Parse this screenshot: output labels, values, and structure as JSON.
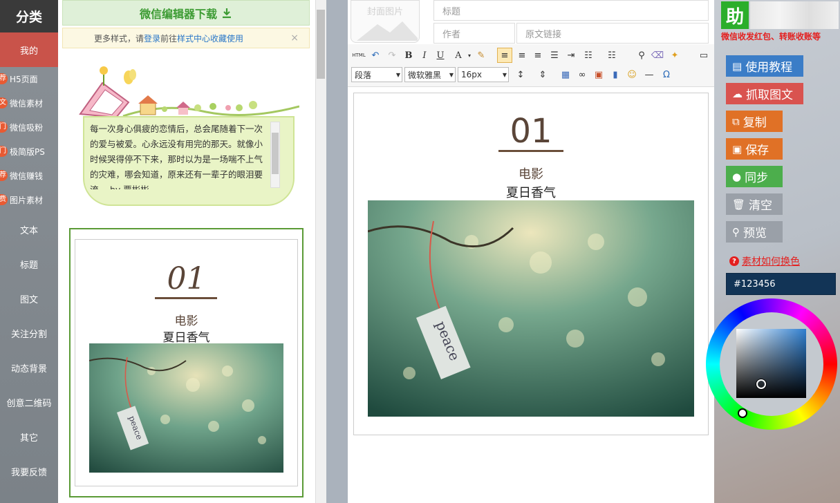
{
  "sidebar": {
    "header": "分类",
    "active_item": "我的",
    "sub_items": [
      {
        "badge": "荐",
        "label": "H5页面"
      },
      {
        "badge": "文",
        "label": "微信素材"
      },
      {
        "badge": "门",
        "label": "微信吸粉"
      },
      {
        "badge": "门",
        "label": "极简版PS"
      },
      {
        "badge": "荐",
        "label": "微信赚钱"
      },
      {
        "badge": "费",
        "label": "图片素材"
      }
    ],
    "categories": [
      "文本",
      "标题",
      "图文",
      "关注分割",
      "动态背景",
      "创意二维码",
      "其它",
      "我要反馈"
    ]
  },
  "templates": {
    "download_label": "微信编辑器下载",
    "notice_prefix": "更多样式，请",
    "notice_login": "登录",
    "notice_mid": "前往",
    "notice_link": "样式中心收藏使用",
    "notice_close": "×",
    "bubble_text": "每一次身心俱疲的恋情后，总会尾随着下一次的爱与被爱。心永远没有用完的那天。就像小时候哭得停不下来，那时以为是一场喘不上气的灾难，哪会知道，原来还有一辈子的眼泪要流。 by 贾彬彬",
    "card": {
      "number": "01",
      "subtitle": "电影",
      "title": "夏日香气",
      "tag_text": "peace"
    }
  },
  "editor": {
    "cover_label": "封面图片",
    "title_placeholder": "标题",
    "author_placeholder": "作者",
    "source_placeholder": "原文链接",
    "toolbar": {
      "html_label": "HTML",
      "bold": "B",
      "italic": "I",
      "underline": "U",
      "font_color": "A",
      "paragraph": "段落",
      "font_family": "微软雅黑",
      "font_size": "16px",
      "omega": "Ω"
    },
    "content": {
      "number": "01",
      "subtitle": "电影",
      "title": "夏日香气",
      "tag_text": "peace"
    }
  },
  "right_panel": {
    "logo_char": "助",
    "slogan": "微信收发红包、转账收账等",
    "buttons": [
      {
        "label": "使用教程",
        "icon": "book-icon",
        "color": "#3b7dc7"
      },
      {
        "label": "抓取图文",
        "icon": "cloud-download-icon",
        "color": "#d9534f"
      },
      {
        "label": "复制",
        "icon": "copy-icon",
        "color": "#e07126"
      },
      {
        "label": "保存",
        "icon": "save-icon",
        "color": "#e07126"
      },
      {
        "label": "同步",
        "icon": "wechat-icon",
        "color": "#4cae4c"
      },
      {
        "label": "清空",
        "icon": "trash-icon",
        "color": "#9aa0a8"
      },
      {
        "label": "预览",
        "icon": "search-icon",
        "color": "#9aa0a8"
      }
    ],
    "help_link": "素材如何换色",
    "color_hex": "#123456"
  }
}
